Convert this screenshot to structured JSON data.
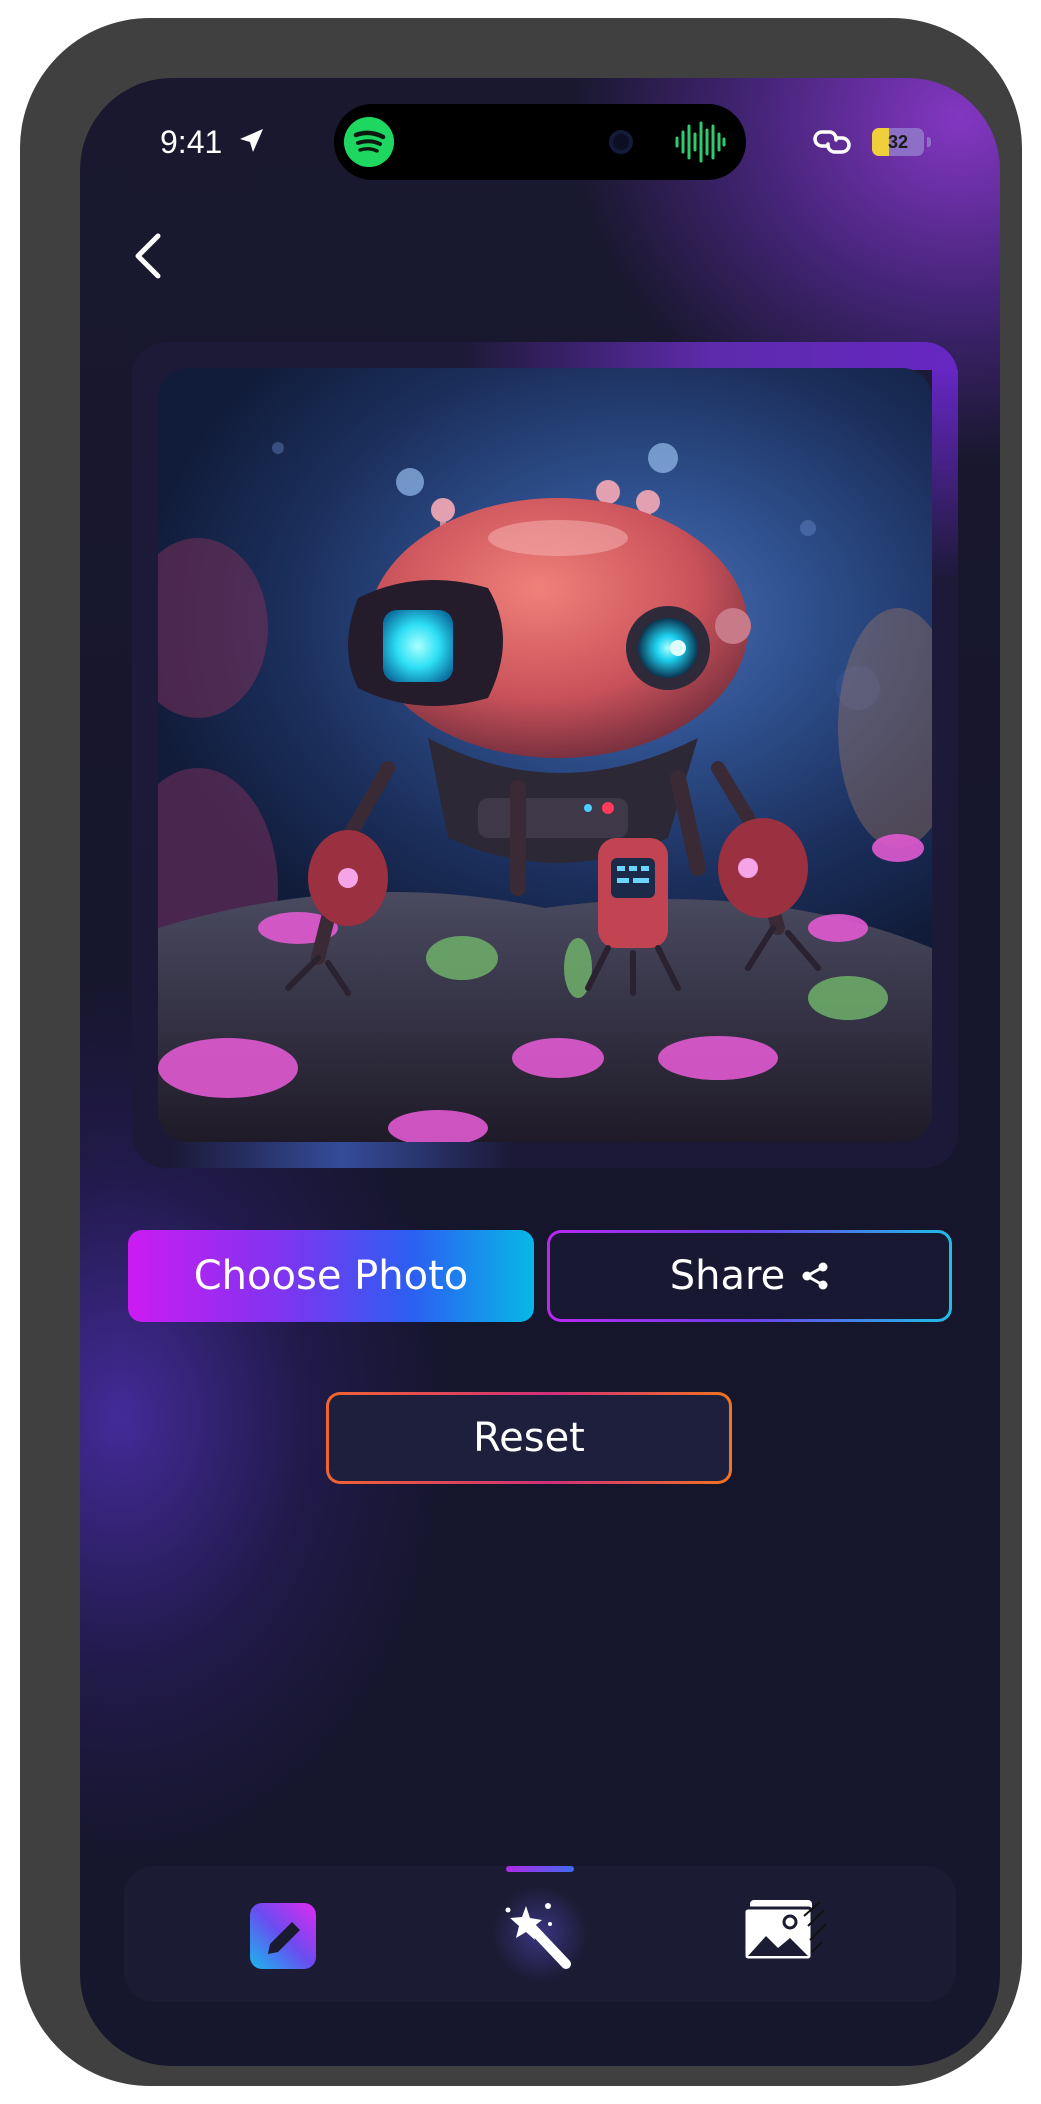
{
  "status_bar": {
    "time": "9:41",
    "battery_level": "32",
    "battery_fraction": 0.32,
    "icons": [
      "location-arrow-icon",
      "spotify-icon",
      "camera-dot-icon",
      "audio-waveform-icon",
      "link-icon",
      "battery-icon"
    ]
  },
  "nav": {
    "back_icon": "chevron-left-icon"
  },
  "actions": {
    "choose_photo_label": "Choose Photo",
    "share_label": "Share",
    "share_icon": "share-icon",
    "reset_label": "Reset"
  },
  "tab_bar": {
    "items": [
      {
        "icon": "edit-pencil-icon",
        "active": false
      },
      {
        "icon": "magic-wand-icon",
        "active": true
      },
      {
        "icon": "gallery-images-icon",
        "active": false
      }
    ]
  },
  "colors": {
    "background": "#16162c",
    "accent_purple": "#cc1bf2",
    "accent_cyan": "#07b8e6",
    "reset_orange": "#f06430",
    "spotify_green": "#1ed760"
  }
}
